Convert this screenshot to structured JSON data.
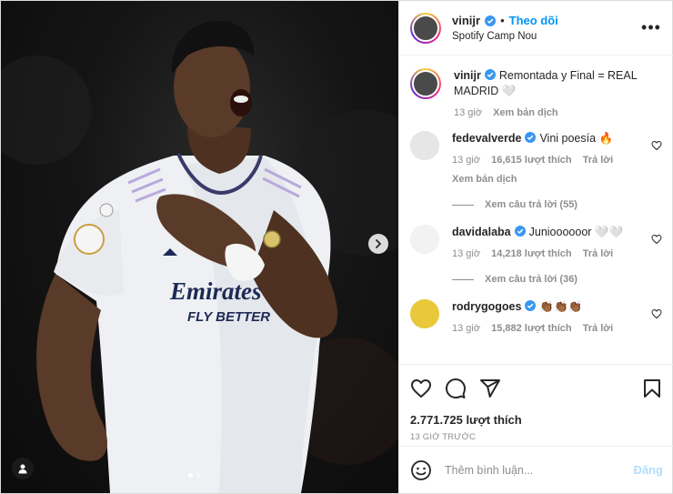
{
  "post": {
    "username": "vinijr",
    "follow_label": "Theo dõi",
    "location": "Spotify Camp Nou",
    "more_label": "•••"
  },
  "caption": {
    "username": "vinijr",
    "text": "Remontada y Final = REAL MADRID 🤍",
    "time": "13 giờ",
    "translate_label": "Xem bản dịch"
  },
  "comments": [
    {
      "username": "fedevalverde",
      "text": "Vini poesía 🔥",
      "time": "13 giờ",
      "likes": "16,615 lượt thích",
      "reply_label": "Trả lời",
      "translate_label": "Xem bản dịch",
      "view_replies": "Xem câu trả lời (55)"
    },
    {
      "username": "davidalaba",
      "text": "Junioooooor 🤍🤍",
      "time": "13 giờ",
      "likes": "14,218 lượt thích",
      "reply_label": "Trả lời",
      "view_replies": "Xem câu trả lời (36)"
    },
    {
      "username": "rodrygogoes",
      "text": "👏🏾👏🏾👏🏾",
      "time": "13 giờ",
      "likes": "15,882 lượt thích",
      "reply_label": "Trả lời"
    }
  ],
  "stats": {
    "likes": "2.771.725 lượt thích",
    "time_ago": "13 GIỜ TRƯỚC"
  },
  "composer": {
    "placeholder": "Thêm bình luận...",
    "post_label": "Đăng"
  },
  "photo": {
    "jersey_sponsor_line1": "Emirates",
    "jersey_sponsor_line2": "FLY BETTER"
  },
  "carousel": {
    "current": 1,
    "total": 2
  },
  "colors": {
    "follow": "#0095f6",
    "verified": "#3897f0",
    "post_disabled": "#b2dffc",
    "muted": "#8e8e8e"
  },
  "icons": {
    "like": "heart-icon",
    "comment": "comment-icon",
    "share": "paper-plane-icon",
    "save": "bookmark-icon",
    "emoji": "smiley-icon",
    "next": "chevron-right-icon",
    "user_tags": "person-icon"
  }
}
